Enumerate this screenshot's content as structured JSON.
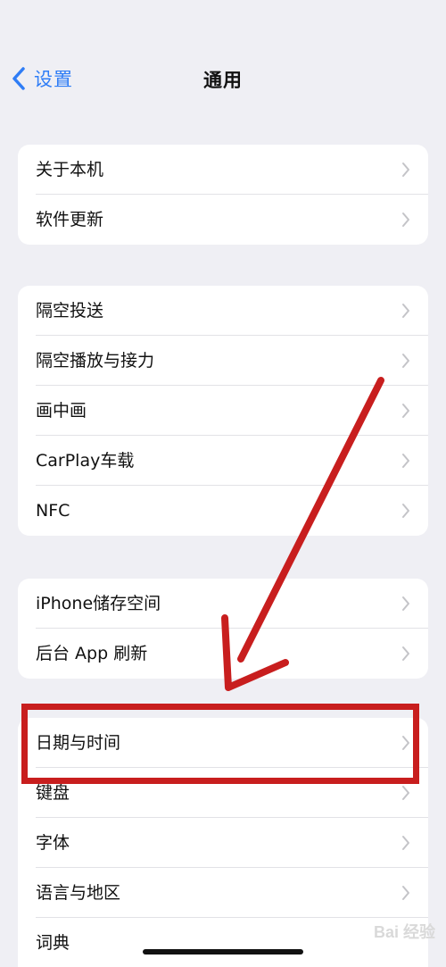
{
  "nav": {
    "back_label": "设置",
    "title": "通用"
  },
  "groups": [
    {
      "items": [
        {
          "label": "关于本机"
        },
        {
          "label": "软件更新"
        }
      ]
    },
    {
      "items": [
        {
          "label": "隔空投送"
        },
        {
          "label": "隔空播放与接力"
        },
        {
          "label": "画中画"
        },
        {
          "label": "CarPlay车载"
        },
        {
          "label": "NFC"
        }
      ]
    },
    {
      "items": [
        {
          "label": "iPhone储存空间"
        },
        {
          "label": "后台 App 刷新"
        }
      ]
    },
    {
      "items": [
        {
          "label": "日期与时间"
        },
        {
          "label": "键盘"
        },
        {
          "label": "字体"
        },
        {
          "label": "语言与地区"
        },
        {
          "label": "词典"
        }
      ]
    }
  ],
  "annotation": {
    "highlight_color": "#c81e1e",
    "highlighted_item": "日期与时间"
  },
  "watermark": "Bai 经验",
  "colors": {
    "background": "#efeff4",
    "accent": "#2f7df6"
  }
}
